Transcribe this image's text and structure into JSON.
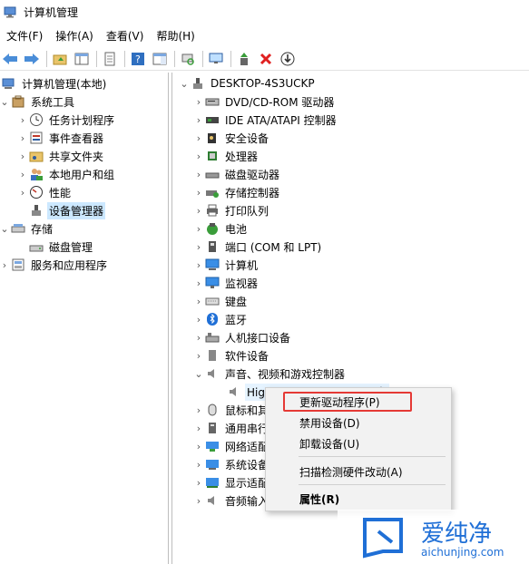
{
  "window": {
    "title": "计算机管理"
  },
  "menu": [
    "文件(F)",
    "操作(A)",
    "查看(V)",
    "帮助(H)"
  ],
  "left_tree": {
    "root": "计算机管理(本地)",
    "system_tools": "系统工具",
    "task_scheduler": "任务计划程序",
    "event_viewer": "事件查看器",
    "shared_folders": "共享文件夹",
    "local_users": "本地用户和组",
    "performance": "性能",
    "device_manager": "设备管理器",
    "storage": "存储",
    "disk_management": "磁盘管理",
    "services_apps": "服务和应用程序"
  },
  "devices": {
    "computer_name": "DESKTOP-4S3UCKP",
    "items": [
      "DVD/CD-ROM 驱动器",
      "IDE ATA/ATAPI 控制器",
      "安全设备",
      "处理器",
      "磁盘驱动器",
      "存储控制器",
      "打印队列",
      "电池",
      "端口 (COM 和 LPT)",
      "计算机",
      "监视器",
      "键盘",
      "蓝牙",
      "人机接口设备",
      "软件设备",
      "声音、视频和游戏控制器"
    ],
    "audio_child": "High Definition Audio 设备",
    "after": [
      "鼠标和其他指针设备",
      "通用串行总线控制器",
      "网络适配器",
      "系统设备",
      "显示适配器",
      "音频输入和输出"
    ]
  },
  "context_menu": {
    "update_driver": "更新驱动程序(P)",
    "disable": "禁用设备(D)",
    "uninstall": "卸载设备(U)",
    "scan": "扫描检测硬件改动(A)",
    "properties": "属性(R)"
  },
  "watermark": {
    "brand": "爱纯净",
    "url": "aichunjing.com"
  }
}
